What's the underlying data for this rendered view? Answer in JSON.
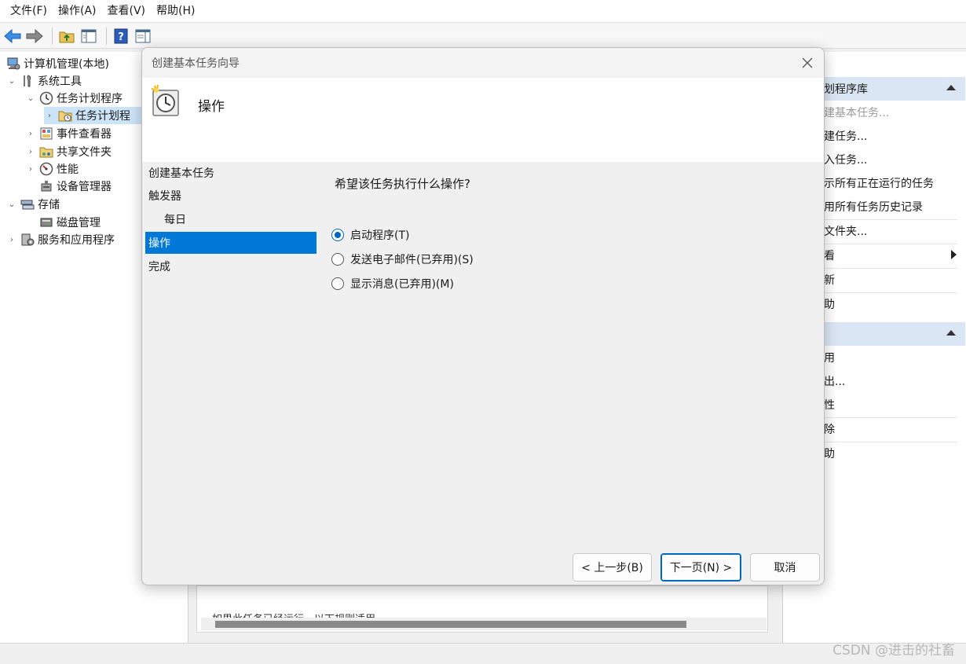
{
  "menubar": {
    "items": [
      "文件(F)",
      "操作(A)",
      "查看(V)",
      "帮助(H)"
    ]
  },
  "toolbar": {
    "buttons": [
      "back-arrow-icon",
      "forward-arrow-icon",
      "folder-up-icon",
      "console-tree-icon",
      "help-icon",
      "action-pane-icon"
    ]
  },
  "tree": {
    "root": "计算机管理(本地)",
    "system_tools": "系统工具",
    "task_scheduler": "任务计划程序",
    "task_scheduler_library": "任务计划程",
    "event_viewer": "事件查看器",
    "shared_folders": "共享文件夹",
    "performance": "性能",
    "device_manager": "设备管理器",
    "storage": "存储",
    "disk_management": "磁盘管理",
    "services_apps": "服务和应用程序"
  },
  "actions": {
    "header1": "划程序库",
    "items1": [
      "建基本任务...",
      "建任务...",
      "入任务...",
      "示所有正在运行的任务",
      "用所有任务历史记录",
      "文件夹...",
      "看",
      "新",
      "助"
    ],
    "items2": [
      "用",
      "出...",
      "性",
      "除",
      "助"
    ]
  },
  "center": {
    "text": "如果此任务已经运行，以下规则适用"
  },
  "wizard": {
    "title": "创建基本任务向导",
    "header_title": "操作",
    "steps": [
      "创建基本任务",
      "触发器",
      "每日",
      "操作",
      "完成"
    ],
    "question": "希望该任务执行什么操作?",
    "options": [
      "启动程序(T)",
      "发送电子邮件(已弃用)(S)",
      "显示消息(已弃用)(M)"
    ],
    "selected_option": 0,
    "buttons": {
      "back": "< 上一步(B)",
      "next": "下一页(N) >",
      "cancel": "取消"
    }
  },
  "watermark": "CSDN @进击的社畜",
  "colors": {
    "accent": "#0078d7",
    "selection": "#cce4f7",
    "action_header": "#dbe6f4"
  }
}
